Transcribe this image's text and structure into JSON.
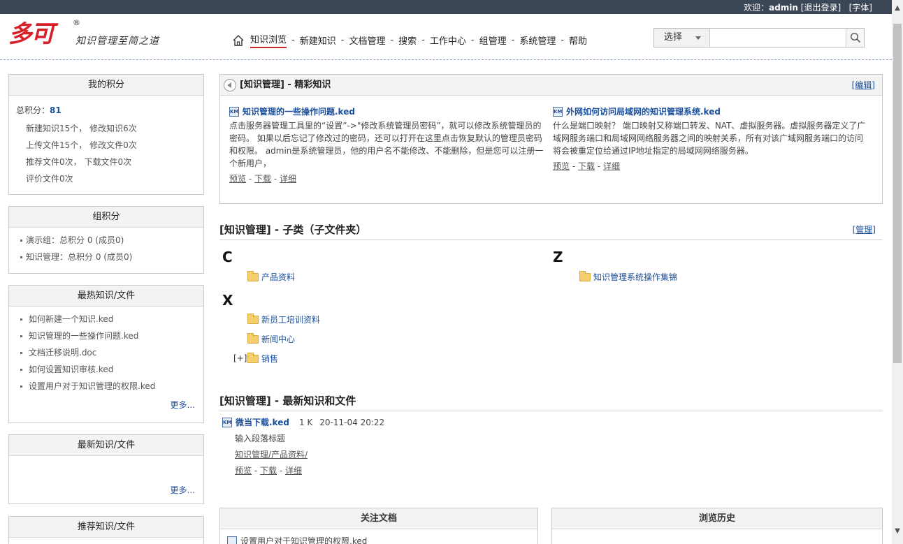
{
  "topbar": {
    "welcome": "欢迎：",
    "user": "admin",
    "logout": "[退出登录]",
    "font": "[字体]"
  },
  "header": {
    "logo_text": "多可",
    "reg": "®",
    "slogan": "知识管理至简之道",
    "nav": [
      "知识浏览",
      "新建知识",
      "文档管理",
      "搜索",
      "工作中心",
      "组管理",
      "系统管理",
      "帮助"
    ],
    "search": {
      "select_label": "选择",
      "value": ""
    }
  },
  "sidebar": {
    "points": {
      "title": "我的积分",
      "total_label": "总积分：",
      "total_value": "81",
      "rows": [
        "新建知识15个， 修改知识6次",
        "上传文件15个， 修改文件0次",
        "推荐文件0次， 下载文件0次",
        "评价文件0次"
      ]
    },
    "group": {
      "title": "组积分",
      "items": [
        "演示组：总积分 0 (成员0)",
        "知识管理：总积分 0 (成员0)"
      ]
    },
    "hot": {
      "title": "最热知识/文件",
      "items": [
        "如何新建一个知识.ked",
        "知识管理的一些操作问题.ked",
        "文档迁移说明.doc",
        "如何设置知识审核.ked",
        "设置用户对于知识管理的权限.ked"
      ],
      "more": "更多..."
    },
    "newest": {
      "title": "最新知识/文件",
      "more": "更多..."
    },
    "recommended": {
      "title": "推荐知识/文件"
    }
  },
  "featured": {
    "title": "[知识管理] - 精彩知识",
    "edit": "[编辑]",
    "items": [
      {
        "icon": "KM",
        "title": "知识管理的一些操作问题.ked",
        "desc": "点击服务器管理工具里的“设置”->\"修改系统管理员密码”，就可以修改系统管理员的密码。 如果以后忘记了修改过的密码，还可以打开在这里点击恢复默认的管理员密码和权限。 admin是系统管理员，他的用户名不能修改、不能删除，但是您可以注册一个新用户，",
        "preview": "预览",
        "download": "下载",
        "detail": "详细"
      },
      {
        "icon": "KM",
        "title": "外网如何访问局域网的知识管理系统.ked",
        "desc": "什么是端口映射？ 端口映射又称端口转发、NAT、虚拟服务器。虚拟服务器定义了广域网服务端口和局域网网络服务器之间的映射关系，所有对该广域网服务端口的访问将会被重定位给通过IP地址指定的局域网网络服务器。",
        "preview": "预览",
        "download": "下载",
        "detail": "详细"
      }
    ]
  },
  "subcats": {
    "title": "[知识管理] - 子类（子文件夹）",
    "manage": "[管理]",
    "letters": [
      "C",
      "X",
      "Z"
    ],
    "folders_c": [
      "产品资料"
    ],
    "folders_x": [
      "新员工培训资料",
      "新闻中心",
      "销售"
    ],
    "folders_z": [
      "知识管理系统操作集锦"
    ],
    "expander": "[+]"
  },
  "latest": {
    "title": "[知识管理] - 最新知识和文件",
    "item": {
      "icon": "KM",
      "name": "微当下载.ked",
      "size": "1 K",
      "date": "20-11-04 20:22",
      "desc": "输入段落标题",
      "path": "知识管理/产品资料/",
      "preview": "预览",
      "download": "下载",
      "detail": "详细"
    }
  },
  "bottom": {
    "watch": {
      "title": "关注文档",
      "first": "设置用户对于知识管理的权限.ked"
    },
    "history": {
      "title": "浏览历史"
    }
  },
  "sep": "-"
}
